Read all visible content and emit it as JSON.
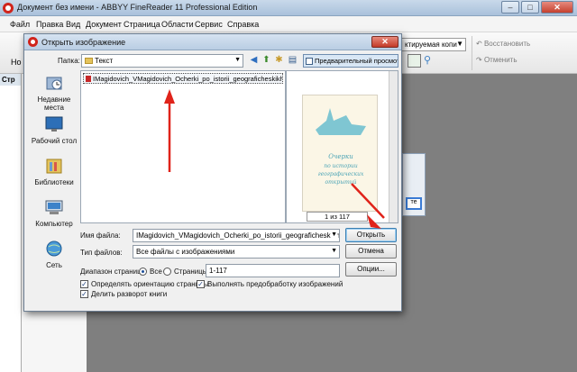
{
  "app": {
    "title": "Документ без имени - ABBYY FineReader 11 Professional Edition",
    "window_buttons": [
      "–",
      "□",
      "✕"
    ],
    "menu": [
      "Файл",
      "Правка",
      "Вид",
      "Документ",
      "Страница",
      "Области",
      "Сервис",
      "Справка"
    ],
    "toolbar": {
      "left_partial": "Но",
      "language_combo": "ктируемая копи",
      "undo_label": "Восстановить",
      "redo_label": "Отменить"
    },
    "left_pane_header": "Стр"
  },
  "dialog": {
    "title": "Открыть изображение",
    "close_label": "✕",
    "folder_label": "Папка:",
    "folder_value": "Текст",
    "preview_toggle": "Предварительный просмотр",
    "places": [
      {
        "label": "Недавние места",
        "icon": "recent-places-icon"
      },
      {
        "label": "Рабочий стол",
        "icon": "desktop-icon"
      },
      {
        "label": "Библиотеки",
        "icon": "libraries-icon"
      },
      {
        "label": "Компьютер",
        "icon": "computer-icon"
      },
      {
        "label": "Сеть",
        "icon": "network-icon"
      }
    ],
    "files": [
      {
        "name": "IMagidovich_VMagidovich_Ocherki_po_istorii_geograficheskikh_ot"
      }
    ],
    "preview": {
      "page_label": "1 из 117",
      "book_title": "Очерки по истории географических открытий"
    },
    "filename_label": "Имя файла:",
    "filename_value": "IMagidovich_VMagidovich_Ocherki_po_istorii_geograficheskikh_otkrytiy_t",
    "filetype_label": "Тип файлов:",
    "filetype_value": "Все файлы с изображениями",
    "open_button": "Открыть",
    "cancel_button": "Отмена",
    "page_range_label": "Диапазон страниц:",
    "range_all_label": "Все",
    "range_pages_label": "Страницы:",
    "range_value": "1-117",
    "options_button": "Опции...",
    "check_orientation": "Определять ориентацию страницы",
    "check_preprocess": "Выполнять предобработку изображений",
    "check_split": "Делить разворот книги",
    "accent_red": "#e0231a"
  }
}
